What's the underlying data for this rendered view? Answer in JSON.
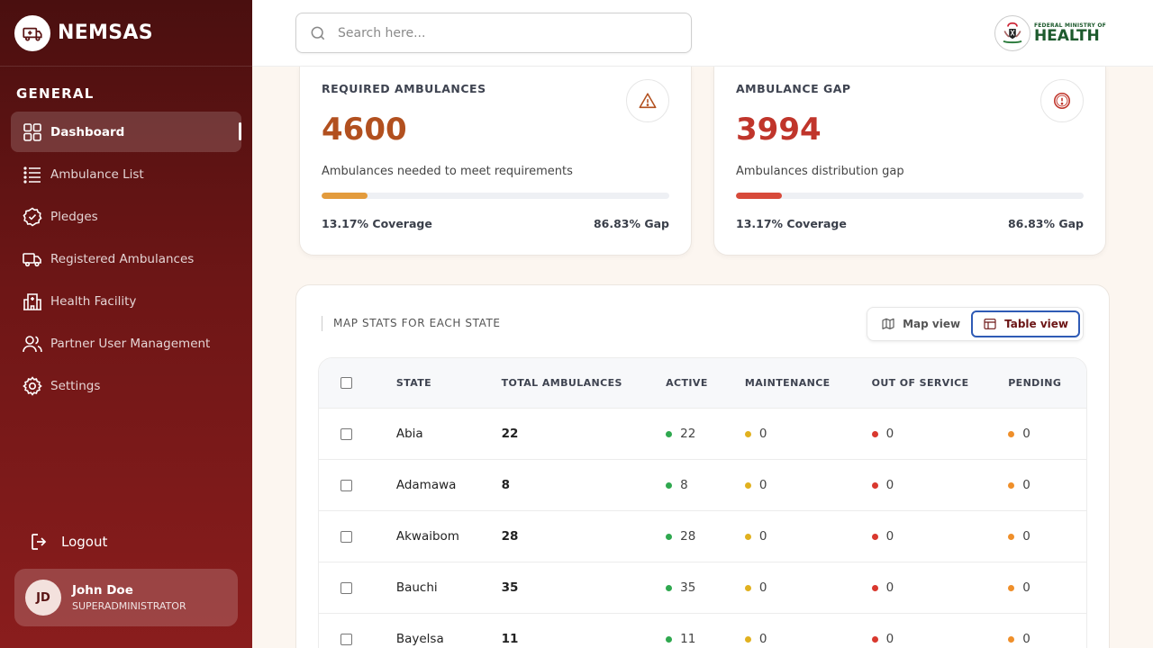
{
  "brand": {
    "name": "NEMSAS"
  },
  "sidebar": {
    "section_title": "GENERAL",
    "items": [
      {
        "label": "Dashboard",
        "icon": "grid-icon",
        "active": true
      },
      {
        "label": "Ambulance List",
        "icon": "list-icon"
      },
      {
        "label": "Pledges",
        "icon": "badge-check-icon"
      },
      {
        "label": "Registered Ambulances",
        "icon": "truck-icon"
      },
      {
        "label": "Health Facility",
        "icon": "hospital-icon"
      },
      {
        "label": "Partner User Management",
        "icon": "users-icon"
      },
      {
        "label": "Settings",
        "icon": "gear-icon"
      }
    ],
    "logout_label": "Logout"
  },
  "user": {
    "initials": "JD",
    "name": "John Doe",
    "role": "SUPERADMINISTRATOR"
  },
  "header": {
    "search_placeholder": "Search here...",
    "ministry_small": "FEDERAL MINISTRY OF",
    "ministry_big": "HEALTH"
  },
  "cards": [
    {
      "label": "REQUIRED AMBULANCES",
      "value": "4600",
      "description": "Ambulances needed to meet requirements",
      "progress_percent": 13.17,
      "coverage": "13.17% Coverage",
      "gap": "86.83% Gap",
      "icon": "warning-triangle-icon",
      "accent": "#b2501f"
    },
    {
      "label": "AMBULANCE GAP",
      "value": "3994",
      "description": "Ambulances distribution gap",
      "progress_percent": 13.17,
      "coverage": "13.17% Coverage",
      "gap": "86.83% Gap",
      "icon": "alert-circle-icon",
      "accent": "#c0352b"
    }
  ],
  "panel": {
    "title": "MAP STATS FOR EACH STATE",
    "map_view_label": "Map view",
    "table_view_label": "Table view",
    "active_view": "table"
  },
  "table": {
    "columns": [
      "STATE",
      "TOTAL AMBULANCES",
      "ACTIVE",
      "MAINTENANCE",
      "OUT OF SERVICE",
      "PENDING"
    ],
    "rows": [
      {
        "state": "Abia",
        "total": "22",
        "active": "22",
        "maintenance": "0",
        "out_of_service": "0",
        "pending": "0"
      },
      {
        "state": "Adamawa",
        "total": "8",
        "active": "8",
        "maintenance": "0",
        "out_of_service": "0",
        "pending": "0"
      },
      {
        "state": "Akwaibom",
        "total": "28",
        "active": "28",
        "maintenance": "0",
        "out_of_service": "0",
        "pending": "0"
      },
      {
        "state": "Bauchi",
        "total": "35",
        "active": "35",
        "maintenance": "0",
        "out_of_service": "0",
        "pending": "0"
      },
      {
        "state": "Bayelsa",
        "total": "11",
        "active": "11",
        "maintenance": "0",
        "out_of_service": "0",
        "pending": "0"
      }
    ]
  },
  "colors": {
    "sidebar_dark": "#4a0f0f",
    "sidebar_light": "#8a1d1d",
    "status_active": "#2fa84f",
    "status_maintenance": "#e1b11f",
    "status_out_of_service": "#d9382e",
    "status_pending": "#ef8f2a"
  }
}
